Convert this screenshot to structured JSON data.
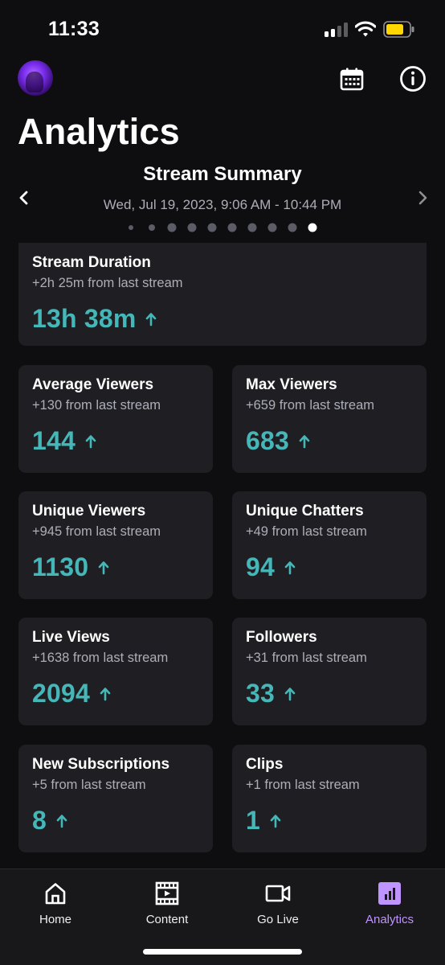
{
  "status_bar": {
    "time": "11:33",
    "signal_icon": "cellular-signal-icon",
    "wifi_icon": "wifi-icon",
    "battery_icon": "battery-icon",
    "battery_color": "#ffd600"
  },
  "header": {
    "avatar_icon": "user-avatar",
    "calendar_icon": "calendar-icon",
    "info_icon": "info-icon",
    "title": "Analytics"
  },
  "summary": {
    "title": "Stream Summary",
    "date": "Wed, Jul 19, 2023, 9:06 AM - 10:44 PM",
    "prev_icon": "chevron-left-icon",
    "next_icon": "chevron-right-icon",
    "page_count": 10,
    "active_page": 10
  },
  "cards": {
    "stream_duration": {
      "title": "Stream Duration",
      "change": "+2h 25m from last stream",
      "value": "13h 38m"
    },
    "average_viewers": {
      "title": "Average Viewers",
      "change": "+130 from last stream",
      "value": "144"
    },
    "max_viewers": {
      "title": "Max Viewers",
      "change": "+659 from last stream",
      "value": "683"
    },
    "unique_viewers": {
      "title": "Unique Viewers",
      "change": "+945 from last stream",
      "value": "1130"
    },
    "unique_chatters": {
      "title": "Unique Chatters",
      "change": "+49 from last stream",
      "value": "94"
    },
    "live_views": {
      "title": "Live Views",
      "change": "+1638 from last stream",
      "value": "2094"
    },
    "followers": {
      "title": "Followers",
      "change": "+31 from last stream",
      "value": "33"
    },
    "new_subscriptions": {
      "title": "New Subscriptions",
      "change": "+5 from last stream",
      "value": "8"
    },
    "clips": {
      "title": "Clips",
      "change": "+1 from last stream",
      "value": "1"
    }
  },
  "tabs": [
    {
      "label": "Home",
      "icon": "home-icon"
    },
    {
      "label": "Content",
      "icon": "film-icon"
    },
    {
      "label": "Go Live",
      "icon": "video-camera-icon"
    },
    {
      "label": "Analytics",
      "icon": "bar-chart-icon"
    }
  ],
  "colors": {
    "background": "#0e0e10",
    "card": "#1f1f23",
    "accent_value": "#45b7b8",
    "active_tab": "#bf94ff",
    "muted_text": "#adadb8"
  }
}
